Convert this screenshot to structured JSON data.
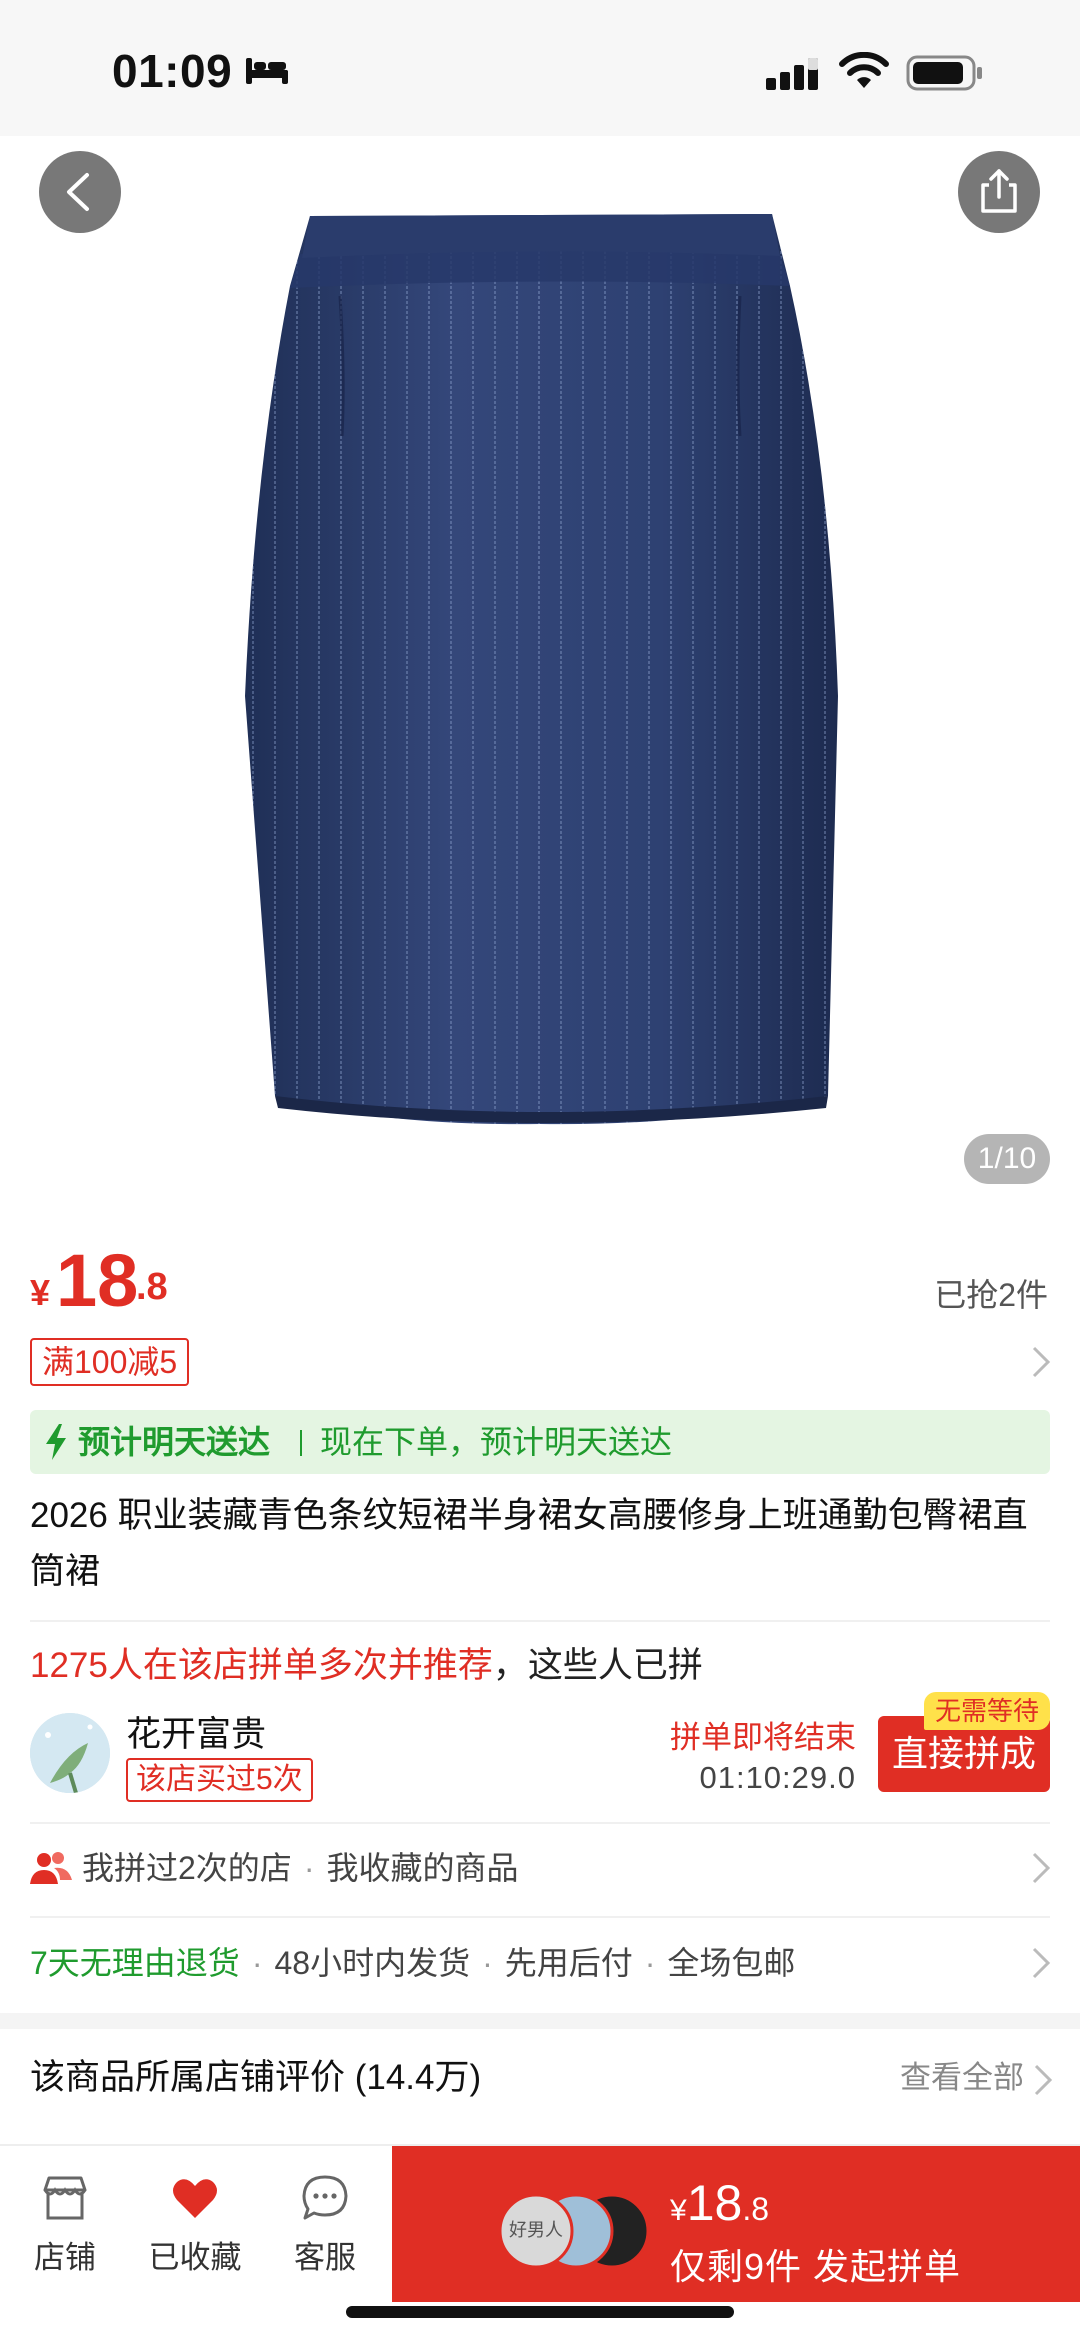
{
  "status_bar": {
    "time": "01:09",
    "icons": [
      "bed-icon",
      "cellular-signal-icon",
      "wifi-icon",
      "battery-icon"
    ]
  },
  "gallery": {
    "counter": "1/10",
    "icons": [
      "back-arrow-icon",
      "share-icon"
    ]
  },
  "price": {
    "symbol": "¥",
    "integer": "18",
    "decimal": ".8",
    "sold": "已抢2件"
  },
  "coupon": {
    "label": "满100减5"
  },
  "delivery": {
    "tag": "预计明天送达",
    "text": "现在下单，预计明天送达"
  },
  "product": {
    "title": "2026 职业装藏青色条纹短裙半身裙女高腰修身上班通勤包臀裙直筒裙"
  },
  "group_buy": {
    "headline_red": "1275人在该店拼单多次并推荐",
    "headline_rest": "，这些人已拼",
    "user_name": "花开富贵",
    "user_badge": "该店买过5次",
    "ending_label": "拼单即将结束",
    "countdown": "01:10:29.0",
    "join_label": "直接拼成",
    "no_wait_tag": "无需等待"
  },
  "shop_info": {
    "joined": "我拼过2次的店",
    "favorited": "我收藏的商品"
  },
  "services": {
    "return": "7天无理由退货",
    "shipping": "48小时内发货",
    "pay_later": "先用后付",
    "free_shipping": "全场包邮"
  },
  "reviews": {
    "title": "该商品所属店铺评价 (14.4万)",
    "view_all": "查看全部"
  },
  "bottom_bar": {
    "store": "店铺",
    "favorited": "已收藏",
    "service": "客服",
    "buy_price_symbol": "¥",
    "buy_price_integer": "18",
    "buy_price_decimal": ".8",
    "buy_label": "仅剩9件 发起拼单",
    "avatar_text": "好男人"
  },
  "colors": {
    "accent_red": "#e02e24",
    "delivery_green": "#1f9b2e",
    "skirt_navy": "#2b3d66"
  }
}
